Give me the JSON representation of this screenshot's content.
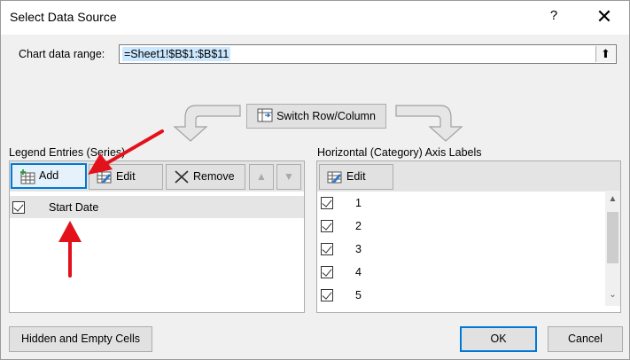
{
  "window": {
    "title": "Select Data Source",
    "help_glyph": "?",
    "close_glyph": "✕"
  },
  "range": {
    "label": "Chart data range:",
    "value": "=Sheet1!$B$1:$B$11",
    "collapse_glyph": "⬆"
  },
  "switch_button": {
    "label": "Switch Row/Column"
  },
  "legend": {
    "label": "Legend Entries (Series)",
    "buttons": {
      "add": "Add",
      "edit": "Edit",
      "remove": "Remove",
      "up": "▲",
      "down": "▼"
    },
    "series": [
      {
        "name": "Start Date",
        "checked": true
      }
    ]
  },
  "axis": {
    "label": "Horizontal (Category) Axis Labels",
    "edit": "Edit",
    "items": [
      "1",
      "2",
      "3",
      "4",
      "5"
    ]
  },
  "footer": {
    "hidden_cells": "Hidden and Empty Cells",
    "ok": "OK",
    "cancel": "Cancel"
  },
  "colors": {
    "accent": "#0078d7",
    "annotation_arrow": "#e3111a",
    "selection": "#cce8ff"
  }
}
